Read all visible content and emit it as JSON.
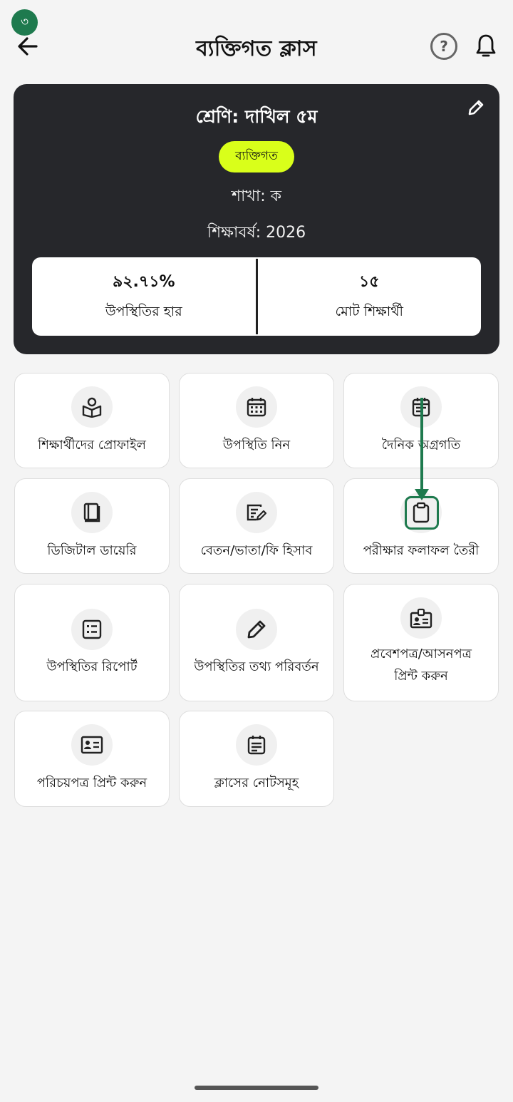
{
  "step_badge": "৩",
  "header": {
    "title": "ব্যক্তিগত ক্লাস",
    "help_symbol": "?"
  },
  "class_card": {
    "class_name": "শ্রেণি: দাখিল ৫ম",
    "type_badge": "ব্যক্তিগত",
    "section": "শাখা: ক",
    "academic_year": "শিক্ষাবর্ষ: 2026",
    "stats": [
      {
        "value": "৯২.৭১%",
        "label": "উপস্থিতির হার"
      },
      {
        "value": "১৫",
        "label": "মোট শিক্ষার্থী"
      }
    ]
  },
  "tiles": [
    {
      "label": "শিক্ষার্থীদের প্রোফাইল",
      "icon": "student-profile-icon"
    },
    {
      "label": "উপস্থিতি নিন",
      "icon": "calendar-icon"
    },
    {
      "label": "দৈনিক অগ্রগতি",
      "icon": "daily-progress-calendar-icon"
    },
    {
      "label": "ডিজিটাল ডায়েরি",
      "icon": "book-icon"
    },
    {
      "label": "বেতন/ভাতা/ফি হিসাব",
      "icon": "note-edit-icon"
    },
    {
      "label": "পরীক্ষার ফলাফল তৈরী",
      "icon": "clipboard-icon"
    },
    {
      "label": "উপস্থিতির রিপোর্ট",
      "icon": "list-report-icon"
    },
    {
      "label": "উপস্থিতির তথ্য পরিবর্তন",
      "icon": "pencil-icon"
    },
    {
      "label_line1": "প্রবেশপত্র/আসনপত্র",
      "label_line2": "প্রিন্ট করুন",
      "icon": "id-badge-icon"
    },
    {
      "label": "পরিচয়পত্র প্রিন্ট করুন",
      "icon": "id-card-icon"
    },
    {
      "label": "ক্লাসের নোটসমূহ",
      "icon": "notes-icon"
    }
  ],
  "colors": {
    "accent_green": "#1e7a4e",
    "badge_yellow": "#d9ff1a",
    "card_dark": "#26272b",
    "background": "#f4f4f4"
  }
}
